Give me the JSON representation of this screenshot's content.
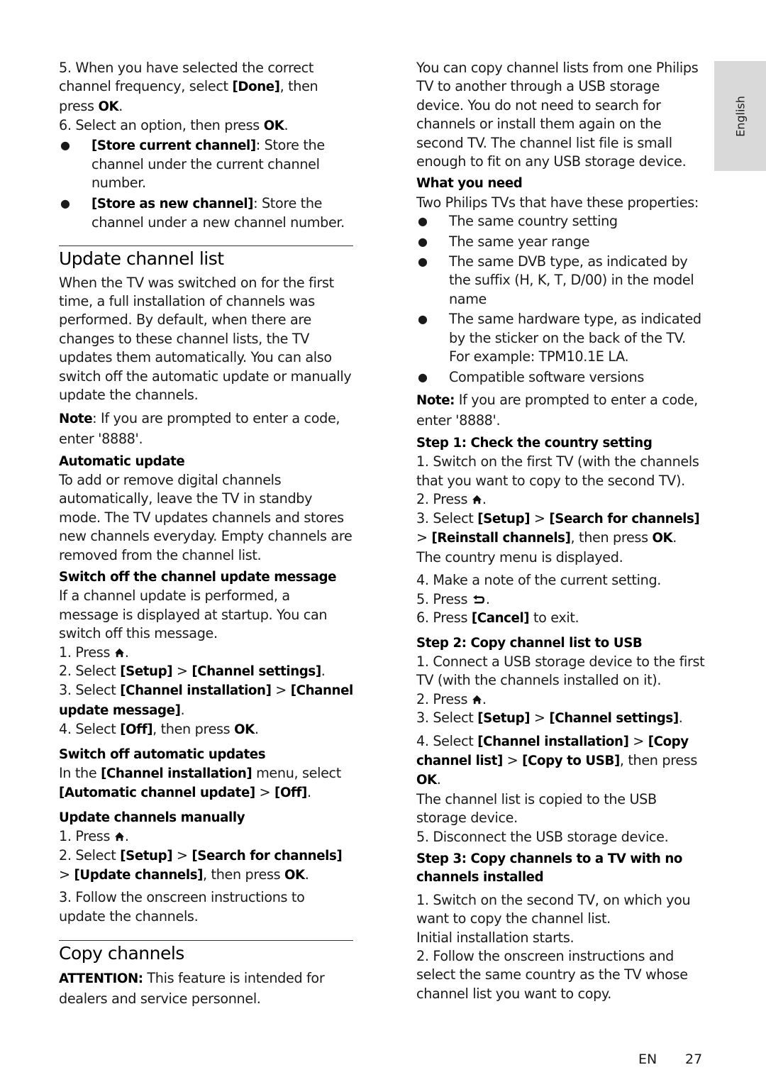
{
  "language_tab": "English",
  "footer": {
    "lang": "EN",
    "page_number": "27"
  },
  "left": {
    "step5": {
      "pre": "5. When you have selected the correct channel frequency, select ",
      "b1": "[Done]",
      "mid": ", then press ",
      "b2": "OK",
      "post": "."
    },
    "step6": {
      "pre": "6. Select an option, then press ",
      "b1": "OK",
      "post": "."
    },
    "bullets": [
      {
        "bold": "[Store current channel]",
        "text": ": Store the channel under the current channel number."
      },
      {
        "bold": "[Store as new channel]",
        "text": ": Store the channel under a new channel number."
      }
    ],
    "update_heading": "Update channel list",
    "update_intro": "When the TV was switched on for the first time, a full installation of channels was performed. By default, when there are changes to these channel lists, the TV updates them automatically. You can also switch off the automatic update or manually update the channels.",
    "note": {
      "label": "Note",
      "text": ": If you are prompted to enter a code, enter '8888'."
    },
    "auto_heading": "Automatic update",
    "auto_text": "To add or remove digital channels automatically, leave the TV in standby mode. The TV updates channels and stores new channels everyday. Empty channels are removed from the channel list.",
    "msg_heading": "Switch off the channel update message",
    "msg_text": "If a channel update is performed, a message is displayed at startup. You can switch off this message.",
    "msg_steps": {
      "s1": "1. Press ",
      "s2": {
        "pre": "2. Select ",
        "b1": "[Setup]",
        "sep": " > ",
        "b2": "[Channel settings]",
        "post": "."
      },
      "s3": {
        "pre": "3. Select ",
        "b1": "[Channel installation]",
        "sep": " > ",
        "b2": "[Channel update message]",
        "post": "."
      },
      "s4": {
        "pre": "4. Select ",
        "b1": "[Off]",
        "mid": ", then press ",
        "b2": "OK",
        "post": "."
      }
    },
    "off_heading": "Switch off automatic updates",
    "off_text": {
      "pre": "In the ",
      "b1": "[Channel installation]",
      "mid": " menu, select ",
      "b2": "[Automatic channel update]",
      "sep": " > ",
      "b3": "[Off]",
      "post": "."
    },
    "manual_heading": "Update channels manually",
    "manual_steps": {
      "s1": "1. Press ",
      "s2": {
        "pre": "2. Select ",
        "b1": "[Setup]",
        "sep": " > ",
        "b2": "[Search for channels]",
        "sep2": " > ",
        "b3": "[Update channels]",
        "mid": ", then press ",
        "b4": "OK",
        "post": "."
      },
      "s3": "3. Follow the onscreen instructions to update the channels."
    },
    "copy_heading": "Copy channels",
    "attention": {
      "label": "ATTENTION:",
      "text": " This feature is intended for dealers and service personnel."
    }
  },
  "right": {
    "intro": "You can copy channel lists from one Philips TV to another through a USB storage device. You do not need to search for channels or install them again on the second TV. The channel list file is small enough to fit on any USB storage device.",
    "need_heading": "What you need",
    "need_text": "Two Philips TVs that have these properties:",
    "need_bullets": [
      "The same country setting",
      "The same year range",
      "The same DVB type, as indicated by the suffix (H, K, T, D/00) in the model name",
      "The same hardware type, as indicated by the sticker on the back of the TV. For example: TPM10.1E LA.",
      "Compatible software versions"
    ],
    "note": {
      "label": "Note:",
      "text": " If you are prompted to enter a code, enter '8888'."
    },
    "step1_heading": "Step 1: Check the country setting",
    "step1": {
      "s1": "1. Switch on the first TV (with the channels that you want to copy to the second TV).",
      "s2": "2. Press ",
      "s3": {
        "pre": "3. Select ",
        "b1": "[Setup]",
        "sep": " > ",
        "b2": "[Search for channels]",
        "sep2": " > ",
        "b3": "[Reinstall channels]",
        "mid": ", then press ",
        "b4": "OK",
        "post": "."
      },
      "s3_result": "The country menu is displayed.",
      "s4": "4. Make a note of the current setting.",
      "s5": "5. Press ",
      "s6": {
        "pre": "6. Press ",
        "b1": "[Cancel]",
        "post": " to exit."
      }
    },
    "step2_heading": "Step 2: Copy channel list to USB",
    "step2": {
      "s1": "1. Connect a USB storage device to the first TV (with the channels installed on it).",
      "s2": "2. Press ",
      "s3": {
        "pre": "3. Select ",
        "b1": "[Setup]",
        "sep": " > ",
        "b2": "[Channel settings]",
        "post": "."
      },
      "s4": {
        "pre": "4. Select ",
        "b1": "[Channel installation]",
        "sep": " > ",
        "b2": "[Copy channel list]",
        "sep2": " > ",
        "b3": "[Copy to USB]",
        "mid": ", then press ",
        "b4": "OK",
        "post": "."
      },
      "s4_result": "The channel list is copied to the USB storage device.",
      "s5": "5. Disconnect the USB storage device."
    },
    "step3_heading": "Step 3: Copy channels to a TV with no channels installed",
    "step3": {
      "s1": "1. Switch on the second TV, on which you want to copy the channel list.",
      "s1_result": "Initial installation starts.",
      "s2": "2. Follow the onscreen instructions and select the same country as the TV whose channel list you want to copy."
    }
  }
}
